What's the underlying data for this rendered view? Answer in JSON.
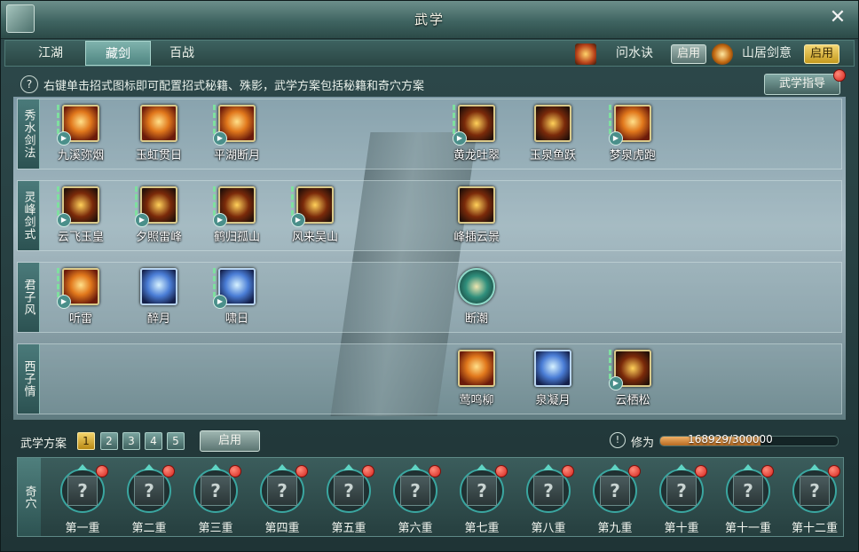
{
  "window": {
    "title": "武学"
  },
  "tabs": [
    {
      "label": "江湖",
      "active": false
    },
    {
      "label": "藏剑",
      "active": true
    },
    {
      "label": "百战",
      "active": false
    }
  ],
  "modes": [
    {
      "name": "问水诀",
      "button": "启用",
      "active": false
    },
    {
      "name": "山居剑意",
      "button": "启用",
      "active": true
    }
  ],
  "hint": "右键单击招式图标即可配置招式秘籍、殊影，武学方案包括秘籍和奇穴方案",
  "guide_button": "武学指导",
  "skill_rows": [
    {
      "label": "秀水剑法",
      "skills": [
        "九溪弥烟",
        "玉虹贯日",
        "平湖断月",
        "黄龙吐翠",
        "玉泉鱼跃",
        "梦泉虎跑"
      ]
    },
    {
      "label": "灵峰剑式",
      "skills": [
        "云飞玉皇",
        "夕照雷峰",
        "鹤归孤山",
        "风来吴山",
        "峰插云景"
      ]
    },
    {
      "label": "君子风",
      "skills": [
        "听雷",
        "醉月",
        "啸日",
        "断潮"
      ]
    },
    {
      "label": "西子情",
      "skills": [
        "莺鸣柳",
        "泉凝月",
        "云栖松"
      ]
    }
  ],
  "plan": {
    "label": "武学方案",
    "numbers": [
      "1",
      "2",
      "3",
      "4",
      "5"
    ],
    "active": "1",
    "apply_button": "启用"
  },
  "xiuwei": {
    "label": "修为",
    "text": "168929/300000",
    "current": 168929,
    "max": 300000
  },
  "meridian": {
    "label": "奇穴",
    "slots": [
      "第一重",
      "第二重",
      "第三重",
      "第四重",
      "第五重",
      "第六重",
      "第七重",
      "第八重",
      "第九重",
      "第十重",
      "第十一重",
      "第十二重"
    ],
    "slot_glyph": "?"
  },
  "colors": {
    "accent_gold": "#f2d36a",
    "teal": "#3aa6a0",
    "alert_red": "#d5241c"
  }
}
